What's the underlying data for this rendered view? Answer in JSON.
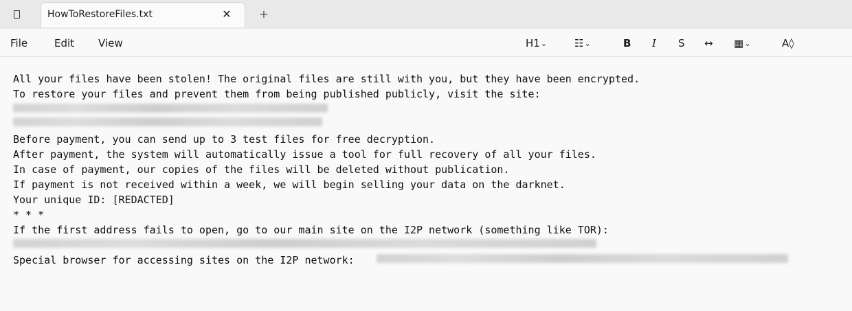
{
  "tab": {
    "title": "HowToRestoreFiles.txt",
    "close_glyph": "✕",
    "new_tab_glyph": "+"
  },
  "menu": {
    "file": "File",
    "edit": "Edit",
    "view": "View"
  },
  "toolbar": {
    "heading": "H1",
    "list_glyph": "☷",
    "bold": "B",
    "italic": "I",
    "strike": "S",
    "link_glyph": "↔",
    "table_glyph": "▦",
    "font_glyph": "A◊",
    "chevron": "⌄"
  },
  "document": {
    "line1": "All your files have been stolen! The original files are still with you, but they have been encrypted.",
    "line2": "To restore your files and prevent them from being published publicly, visit the site:",
    "line5": "Before payment, you can send up to 3 test files for free decryption.",
    "line6": "After payment, the system will automatically issue a tool for full recovery of all your files.",
    "line7": "In case of payment, our copies of the files will be deleted without publication.",
    "line8": "If payment is not received within a week, we will begin selling your data on the darknet.",
    "line9": "Your unique ID: [REDACTED]",
    "line10": "* * *",
    "line11": "If the first address fails to open, go to our main site on the I2P network (something like TOR):",
    "line13": "Special browser for accessing sites on the I2P network:"
  },
  "icons": {
    "app": "document-icon",
    "close": "close-icon",
    "new_tab": "plus-icon"
  }
}
